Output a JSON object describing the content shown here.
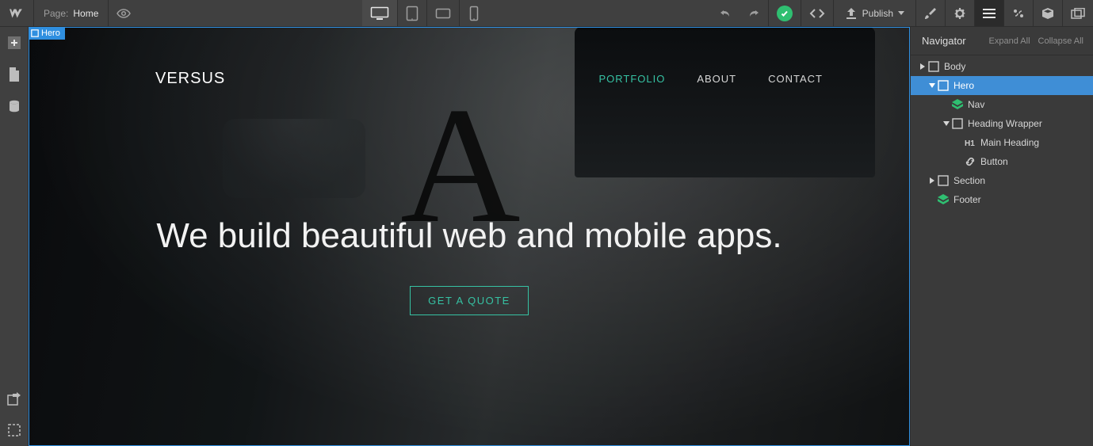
{
  "topbar": {
    "page_label": "Page:",
    "page_name": "Home",
    "publish_label": "Publish",
    "devices": [
      "desktop",
      "tablet",
      "tablet-landscape",
      "phone"
    ],
    "active_device": "desktop"
  },
  "leftbar": {
    "items": [
      "add",
      "pages",
      "cms"
    ],
    "bottom_items": [
      "export",
      "selection"
    ]
  },
  "right_tabs": {
    "active": "navigator",
    "items": [
      "style",
      "settings",
      "navigator",
      "interactions",
      "assets",
      "backup"
    ]
  },
  "navigator": {
    "title": "Navigator",
    "expand_label": "Expand All",
    "collapse_label": "Collapse All",
    "tree": [
      {
        "id": "body",
        "label": "Body",
        "icon": "section",
        "indent": 0,
        "expanded": false,
        "has_children": true
      },
      {
        "id": "hero",
        "label": "Hero",
        "icon": "section",
        "indent": 1,
        "expanded": true,
        "has_children": true,
        "selected": true
      },
      {
        "id": "nav",
        "label": "Nav",
        "icon": "symbol",
        "indent": 2,
        "expanded": false,
        "has_children": false
      },
      {
        "id": "heading-wrapper",
        "label": "Heading Wrapper",
        "icon": "section",
        "indent": 2,
        "expanded": true,
        "has_children": true
      },
      {
        "id": "main-heading",
        "label": "Main Heading",
        "icon": "h1",
        "indent": 3,
        "expanded": false,
        "has_children": false
      },
      {
        "id": "button",
        "label": "Button",
        "icon": "link",
        "indent": 3,
        "expanded": false,
        "has_children": false
      },
      {
        "id": "section",
        "label": "Section",
        "icon": "section",
        "indent": 1,
        "expanded": false,
        "has_children": true
      },
      {
        "id": "footer",
        "label": "Footer",
        "icon": "symbol",
        "indent": 1,
        "expanded": false,
        "has_children": false
      }
    ]
  },
  "canvas": {
    "selected_label": "Hero",
    "site": {
      "brand": "VERSUS",
      "menu": [
        {
          "label": "PORTFOLIO",
          "active": true
        },
        {
          "label": "ABOUT",
          "active": false
        },
        {
          "label": "CONTACT",
          "active": false
        }
      ],
      "heading": "We build beautiful web and mobile apps.",
      "cta_label": "GET A QUOTE"
    }
  },
  "colors": {
    "accent_teal": "#36c2a3",
    "selection_blue": "#2f8fe0",
    "success_green": "#2fbf71"
  }
}
